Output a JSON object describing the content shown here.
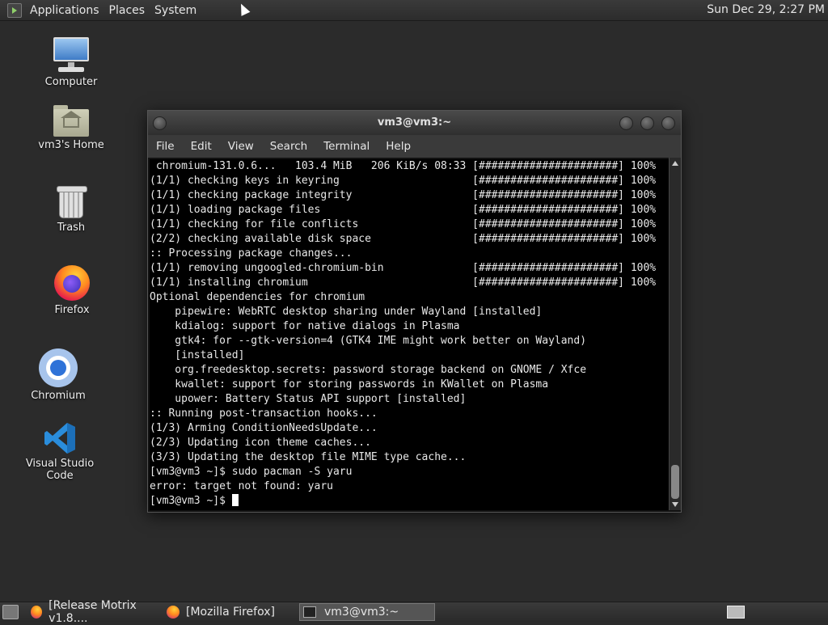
{
  "top_panel": {
    "menus": [
      "Applications",
      "Places",
      "System"
    ],
    "clock": "Sun Dec 29,  2:27 PM"
  },
  "desktop_icons": [
    {
      "label": "Computer",
      "icon": "computer-icon"
    },
    {
      "label": "vm3's Home",
      "icon": "home-folder-icon"
    },
    {
      "label": "Trash",
      "icon": "trash-icon"
    },
    {
      "label": "Firefox",
      "icon": "firefox-icon"
    },
    {
      "label": "Chromium",
      "icon": "chromium-icon"
    },
    {
      "label": "Visual Studio Code",
      "icon": "vscode-icon"
    }
  ],
  "terminal": {
    "title": "vm3@vm3:~",
    "menus": [
      "File",
      "Edit",
      "View",
      "Search",
      "Terminal",
      "Help"
    ],
    "lines": [
      " chromium-131.0.6...   103.4 MiB   206 KiB/s 08:33 [######################] 100%",
      "(1/1) checking keys in keyring                     [######################] 100%",
      "(1/1) checking package integrity                   [######################] 100%",
      "(1/1) loading package files                        [######################] 100%",
      "(1/1) checking for file conflicts                  [######################] 100%",
      "(2/2) checking available disk space                [######################] 100%",
      ":: Processing package changes...",
      "(1/1) removing ungoogled-chromium-bin              [######################] 100%",
      "(1/1) installing chromium                          [######################] 100%",
      "Optional dependencies for chromium",
      "    pipewire: WebRTC desktop sharing under Wayland [installed]",
      "    kdialog: support for native dialogs in Plasma",
      "    gtk4: for --gtk-version=4 (GTK4 IME might work better on Wayland)",
      "    [installed]",
      "    org.freedesktop.secrets: password storage backend on GNOME / Xfce",
      "    kwallet: support for storing passwords in KWallet on Plasma",
      "    upower: Battery Status API support [installed]",
      ":: Running post-transaction hooks...",
      "(1/3) Arming ConditionNeedsUpdate...",
      "(2/3) Updating icon theme caches...",
      "(3/3) Updating the desktop file MIME type cache...",
      "[vm3@vm3 ~]$ sudo pacman -S yaru",
      "error: target not found: yaru"
    ],
    "prompt": "[vm3@vm3 ~]$ "
  },
  "taskbar": {
    "tasks": [
      {
        "label": "[Release Motrix v1.8....",
        "icon": "firefox-icon",
        "active": false
      },
      {
        "label": "[Mozilla Firefox]",
        "icon": "firefox-icon",
        "active": false
      },
      {
        "label": "vm3@vm3:~",
        "icon": "terminal-icon",
        "active": true
      }
    ]
  }
}
